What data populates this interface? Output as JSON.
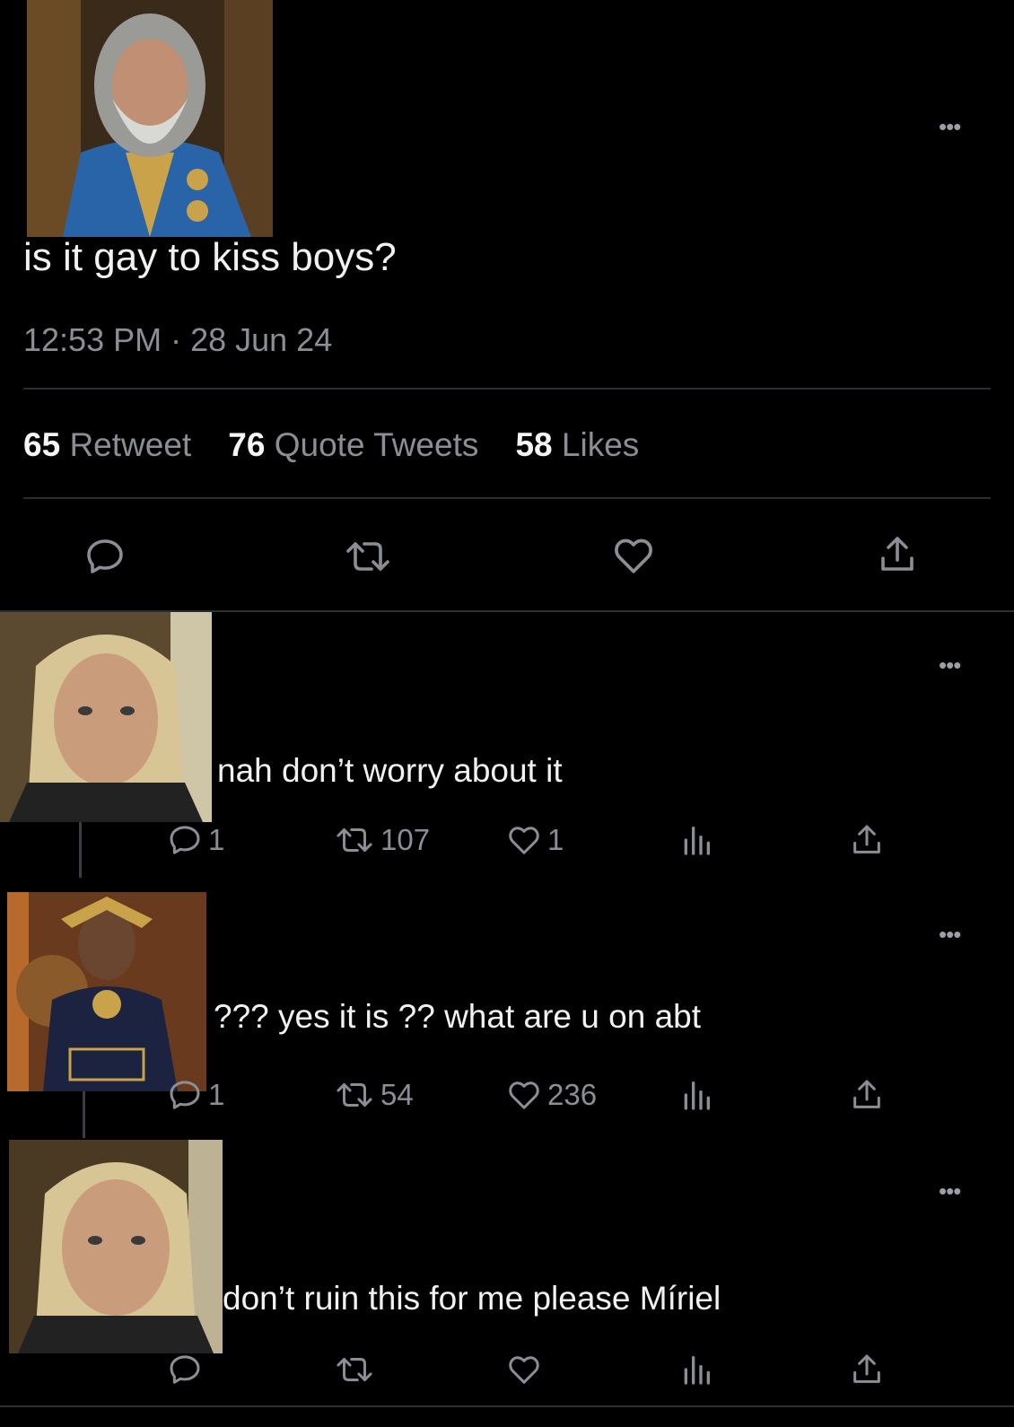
{
  "main_tweet": {
    "text": "is it gay to kiss boys?",
    "timestamp": "12:53 PM · 28 Jun 24",
    "stats": [
      {
        "num": "65",
        "label": "Retweet"
      },
      {
        "num": "76",
        "label": "Quote Tweets"
      },
      {
        "num": "58",
        "label": "Likes"
      }
    ],
    "actions": [
      "reply-icon",
      "retweet-icon",
      "like-icon",
      "share-icon"
    ],
    "more_icon": "more-icon"
  },
  "replies": [
    {
      "text": "nah don’t worry about it",
      "reply_count": "1",
      "retweet_count": "107",
      "like_count": "1"
    },
    {
      "text": "??? yes it is ?? what are u on abt",
      "reply_count": "1",
      "retweet_count": "54",
      "like_count": "236"
    },
    {
      "text": "don’t ruin this for me please Míriel",
      "reply_count": "",
      "retweet_count": "",
      "like_count": ""
    }
  ],
  "colors": {
    "background": "#000000",
    "text": "#f1f1f1",
    "muted": "#8a8f95",
    "divider": "#2a2d31"
  }
}
